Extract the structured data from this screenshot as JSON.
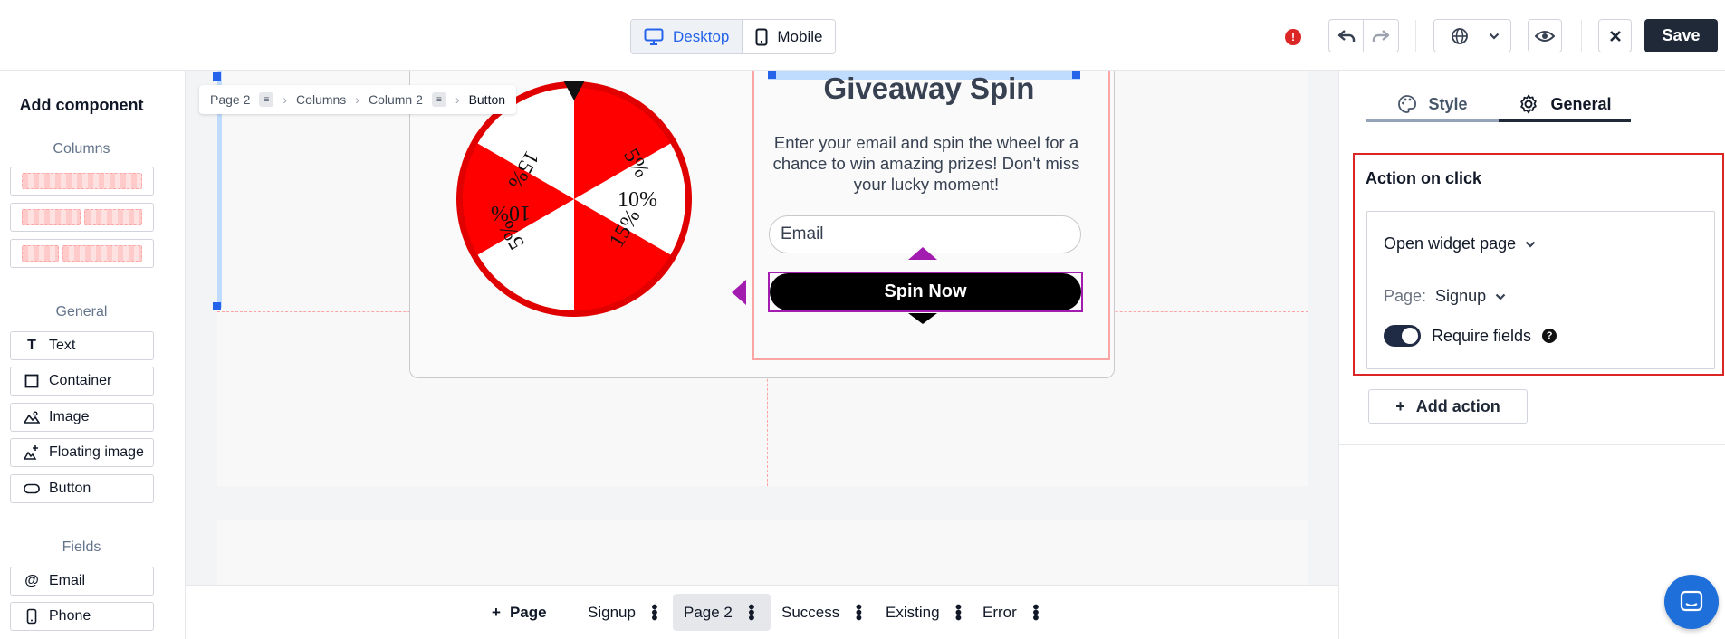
{
  "topbar": {
    "device_desktop": "Desktop",
    "device_mobile": "Mobile",
    "save_label": "Save"
  },
  "sidebar": {
    "title": "Add component",
    "sections": {
      "columns": "Columns",
      "general": "General",
      "fields": "Fields"
    },
    "general_items": [
      "Text",
      "Container",
      "Image",
      "Floating image",
      "Button"
    ],
    "field_items": [
      "Email",
      "Phone"
    ]
  },
  "breadcrumb": [
    "Page 2",
    "Columns",
    "Column 2",
    "Button"
  ],
  "widget": {
    "wheel_labels": [
      "5%",
      "10%",
      "15%",
      "5%",
      "10%",
      "15%"
    ],
    "wheel_colors": {
      "red": "#ff0000",
      "white": "#ffffff"
    },
    "heading": "Giveaway Spin",
    "description": "Enter your email and spin the wheel for a chance to win amazing prizes! Don't miss your lucky moment!",
    "email_placeholder": "Email",
    "button_label": "Spin Now"
  },
  "pages": {
    "add_label": "Page",
    "items": [
      {
        "label": "Signup",
        "active": false
      },
      {
        "label": "Page 2",
        "active": true
      },
      {
        "label": "Success",
        "active": false
      },
      {
        "label": "Existing",
        "active": false
      },
      {
        "label": "Error",
        "active": false
      }
    ]
  },
  "right_panel": {
    "tabs": [
      "Style",
      "General"
    ],
    "active_tab": "General",
    "action_title": "Action on click",
    "action_type": "Open widget page",
    "page_label": "Page:",
    "page_value": "Signup",
    "require_fields_label": "Require fields",
    "require_fields_on": true,
    "add_action_label": "Add action"
  },
  "colors": {
    "accent": "#2563eb",
    "save_bg": "#1f2937",
    "highlight": "#dc2626",
    "selection": "#a21caf"
  }
}
